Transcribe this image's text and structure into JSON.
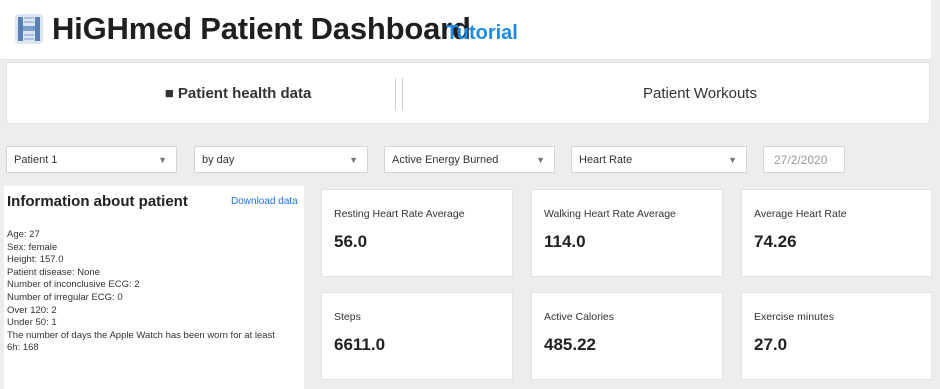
{
  "header": {
    "title": "HiGHmed Patient Dashboard",
    "tutorial_link": "Tutorial",
    "accent_color": "#1a8be6"
  },
  "tabs": [
    {
      "label": "■ Patient health data",
      "active": true
    },
    {
      "label": "Patient Workouts",
      "active": false
    }
  ],
  "filters": {
    "patient": "Patient 1",
    "period": "by day",
    "metric_1": "Active Energy Burned",
    "metric_2": "Heart Rate",
    "date": "27/2/2020"
  },
  "patient_info": {
    "title": "Information about patient",
    "download_label": "Download data",
    "lines": [
      "Age: 27",
      "Sex: female",
      "Height: 157.0",
      "Patient disease: None",
      "Number of inconclusive ECG: 2",
      "Number of irregular ECG: 0",
      "Over 120: 2",
      "Under 50: 1",
      "The number of days the Apple Watch has been worn for at least",
      "6h: 168"
    ]
  },
  "stats": [
    {
      "label": "Resting Heart Rate Average",
      "value": "56.0"
    },
    {
      "label": "Walking Heart Rate Average",
      "value": "114.0"
    },
    {
      "label": "Average Heart Rate",
      "value": "74.26"
    },
    {
      "label": "Steps",
      "value": "6611.0"
    },
    {
      "label": "Active Calories",
      "value": "485.22"
    },
    {
      "label": "Exercise minutes",
      "value": "27.0"
    }
  ]
}
